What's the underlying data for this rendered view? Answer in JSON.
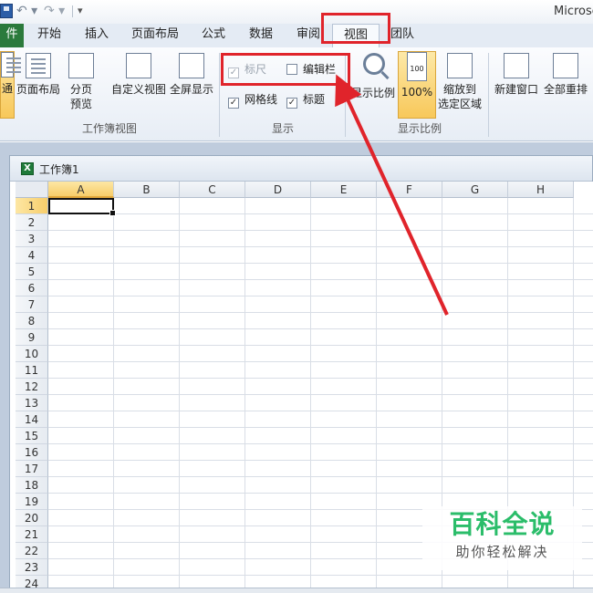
{
  "window": {
    "app_title": "Microso"
  },
  "qat": {
    "save_icon": "save-icon",
    "undo_icon": "undo-icon",
    "redo_icon": "redo-icon",
    "undo_glyph": "↶ ▾",
    "redo_glyph": "↷ ▾",
    "customize_glyph": "▾"
  },
  "tabs": [
    {
      "label": "件"
    },
    {
      "label": "开始"
    },
    {
      "label": "插入"
    },
    {
      "label": "页面布局"
    },
    {
      "label": "公式"
    },
    {
      "label": "数据"
    },
    {
      "label": "审阅"
    },
    {
      "label": "视图"
    },
    {
      "label": "团队"
    }
  ],
  "ribbon": {
    "workbook_views": {
      "group_label": "工作簿视图",
      "buttons": [
        {
          "label": "通"
        },
        {
          "label": "页面布局"
        },
        {
          "label": "分页",
          "label2": "预览"
        },
        {
          "label": "自定义视图"
        },
        {
          "label": "全屏显示"
        }
      ]
    },
    "show": {
      "group_label": "显示",
      "ruler": {
        "label": "标尺",
        "checked": true,
        "enabled": false
      },
      "formula_bar": {
        "label": "编辑栏",
        "checked": false
      },
      "gridlines": {
        "label": "网格线",
        "checked": true
      },
      "headings": {
        "label": "标题",
        "checked": true
      },
      "check_glyph": "✓"
    },
    "zoom": {
      "group_label": "显示比例",
      "zoom_button": {
        "label": "显示比例"
      },
      "hundred_button": {
        "label": "100%",
        "icon_text": "100"
      },
      "zoom_selection": {
        "label": "缩放到",
        "label2": "选定区域"
      }
    },
    "window_group": {
      "new_window": {
        "label": "新建窗口"
      },
      "arrange_all": {
        "label": "全部重排"
      }
    }
  },
  "workbook": {
    "title": "工作簿1",
    "icon_letter": "X",
    "columns": [
      "A",
      "B",
      "C",
      "D",
      "E",
      "F",
      "G",
      "H"
    ],
    "rows": [
      "1",
      "2",
      "3",
      "4",
      "5",
      "6",
      "7",
      "8",
      "9",
      "10",
      "11",
      "12",
      "13",
      "14",
      "15",
      "16",
      "17",
      "18",
      "19",
      "20",
      "21",
      "22",
      "23",
      "24"
    ],
    "active_cell": "A1"
  },
  "watermark": {
    "main": "百科全说",
    "sub": "助你轻松解决"
  },
  "colors": {
    "annotation": "#e0242b",
    "file_tab": "#2b7a3c",
    "watermark": "#2bbd6a"
  }
}
